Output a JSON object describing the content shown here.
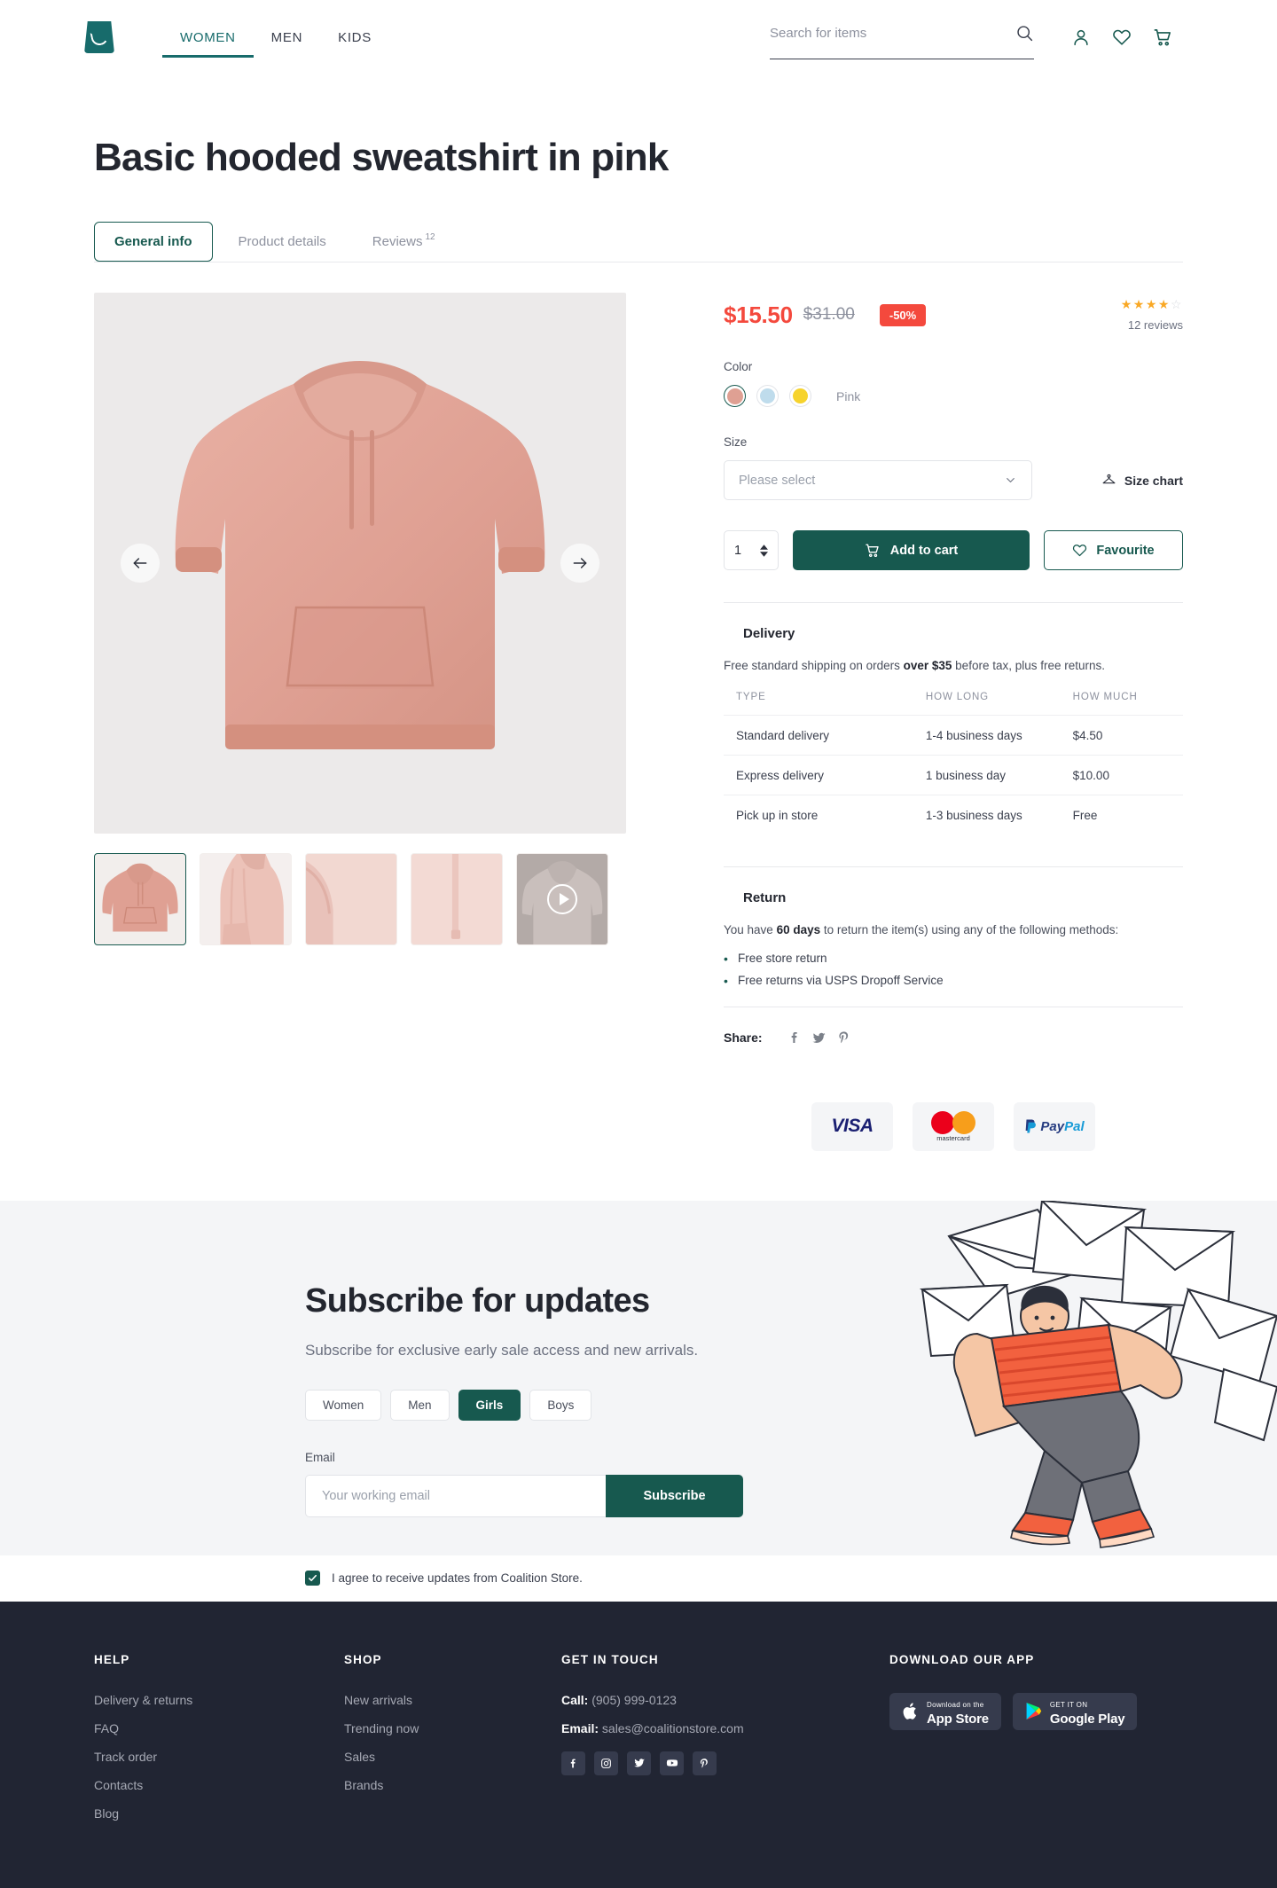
{
  "header": {
    "logo": "shopping-bag-logo",
    "nav": [
      {
        "label": "WOMEN",
        "active": true
      },
      {
        "label": "MEN",
        "active": false
      },
      {
        "label": "KIDS",
        "active": false
      }
    ],
    "search": {
      "placeholder": "Search for items",
      "value": ""
    },
    "icons": [
      "search-icon",
      "account-icon",
      "wishlist-heart-icon",
      "cart-icon"
    ]
  },
  "product": {
    "title": "Basic hooded sweatshirt in pink",
    "tabs": [
      {
        "label": "General info",
        "badge": "",
        "active": true
      },
      {
        "label": "Product details",
        "badge": "",
        "active": false
      },
      {
        "label": "Reviews",
        "badge": "12",
        "active": false
      }
    ],
    "price_now": "$15.50",
    "price_old": "$31.00",
    "discount": "-50%",
    "rating": 4,
    "rating_max": 5,
    "reviews_count": "12 reviews",
    "color_label": "Color",
    "colors": [
      {
        "name": "Pink",
        "hex": "#dfa093",
        "selected": true
      },
      {
        "name": "Blue",
        "hex": "#bfdcec",
        "selected": false
      },
      {
        "name": "Yellow",
        "hex": "#f6d32d",
        "selected": false
      }
    ],
    "selected_color_name": "Pink",
    "size_label": "Size",
    "size_placeholder": "Please select",
    "size_chart_label": "Size chart",
    "quantity": "1",
    "add_to_cart_label": "Add to cart",
    "favourite_label": "Favourite",
    "thumbnails": [
      {
        "name": "front-view",
        "selected": true,
        "video": false
      },
      {
        "name": "model-view",
        "selected": false,
        "video": false
      },
      {
        "name": "fabric-detail",
        "selected": false,
        "video": false
      },
      {
        "name": "seam-detail",
        "selected": false,
        "video": false
      },
      {
        "name": "video-preview",
        "selected": false,
        "video": true
      }
    ]
  },
  "delivery": {
    "heading": "Delivery",
    "note_prefix": "Free standard shipping on orders ",
    "note_bold": "over $35",
    "note_suffix": " before tax, plus free returns.",
    "columns": [
      "TYPE",
      "HOW LONG",
      "HOW MUCH"
    ],
    "rows": [
      [
        "Standard delivery",
        "1-4 business days",
        "$4.50"
      ],
      [
        "Express delivery",
        "1 business day",
        "$10.00"
      ],
      [
        "Pick up in store",
        "1-3 business days",
        "Free"
      ]
    ]
  },
  "returns": {
    "heading": "Return",
    "note_prefix": "You have ",
    "note_bold": "60 days",
    "note_suffix": " to return the item(s) using any of the following methods:",
    "methods": [
      "Free store return",
      "Free returns via USPS Dropoff Service"
    ]
  },
  "share": {
    "label": "Share:",
    "networks": [
      "facebook-icon",
      "twitter-icon",
      "pinterest-icon"
    ]
  },
  "payments": [
    {
      "name": "visa-logo",
      "text": "VISA"
    },
    {
      "name": "mastercard-logo",
      "text": "mastercard"
    },
    {
      "name": "paypal-logo",
      "text": "PayPal"
    }
  ],
  "subscribe": {
    "title": "Subscribe for updates",
    "subtitle": "Subscribe for exclusive early sale access and new arrivals.",
    "chips": [
      {
        "label": "Women",
        "active": false
      },
      {
        "label": "Men",
        "active": false
      },
      {
        "label": "Girls",
        "active": true
      },
      {
        "label": "Boys",
        "active": false
      }
    ],
    "email_label": "Email",
    "email_placeholder": "Your working email",
    "email_value": "",
    "button_label": "Subscribe",
    "agree_text": "I agree to receive updates from Coalition Store.",
    "agree_checked": true
  },
  "footer": {
    "columns": [
      {
        "heading": "HELP",
        "links": [
          "Delivery & returns",
          "FAQ",
          "Track order",
          "Contacts",
          "Blog"
        ]
      },
      {
        "heading": "SHOP",
        "links": [
          "New arrivals",
          "Trending now",
          "Sales",
          "Brands"
        ]
      }
    ],
    "contact": {
      "heading": "GET IN TOUCH",
      "call_label": "Call:",
      "call_value": "(905) 999-0123",
      "email_label": "Email:",
      "email_value": "sales@coalitionstore.com",
      "socials": [
        "facebook-icon",
        "instagram-icon",
        "twitter-icon",
        "youtube-icon",
        "pinterest-icon"
      ]
    },
    "app": {
      "heading": "DOWNLOAD OUR APP",
      "apple": {
        "line1": "Download on the",
        "line2": "App Store"
      },
      "google": {
        "line1": "GET IT ON",
        "line2": "Google Play"
      }
    }
  },
  "colors": {
    "brand_teal": "#17594f",
    "logo_teal": "#176b6b",
    "sale_red": "#f4493d",
    "star_orange": "#f9a825",
    "footer_bg": "#212533",
    "subscribe_bg": "#f4f5f7"
  }
}
